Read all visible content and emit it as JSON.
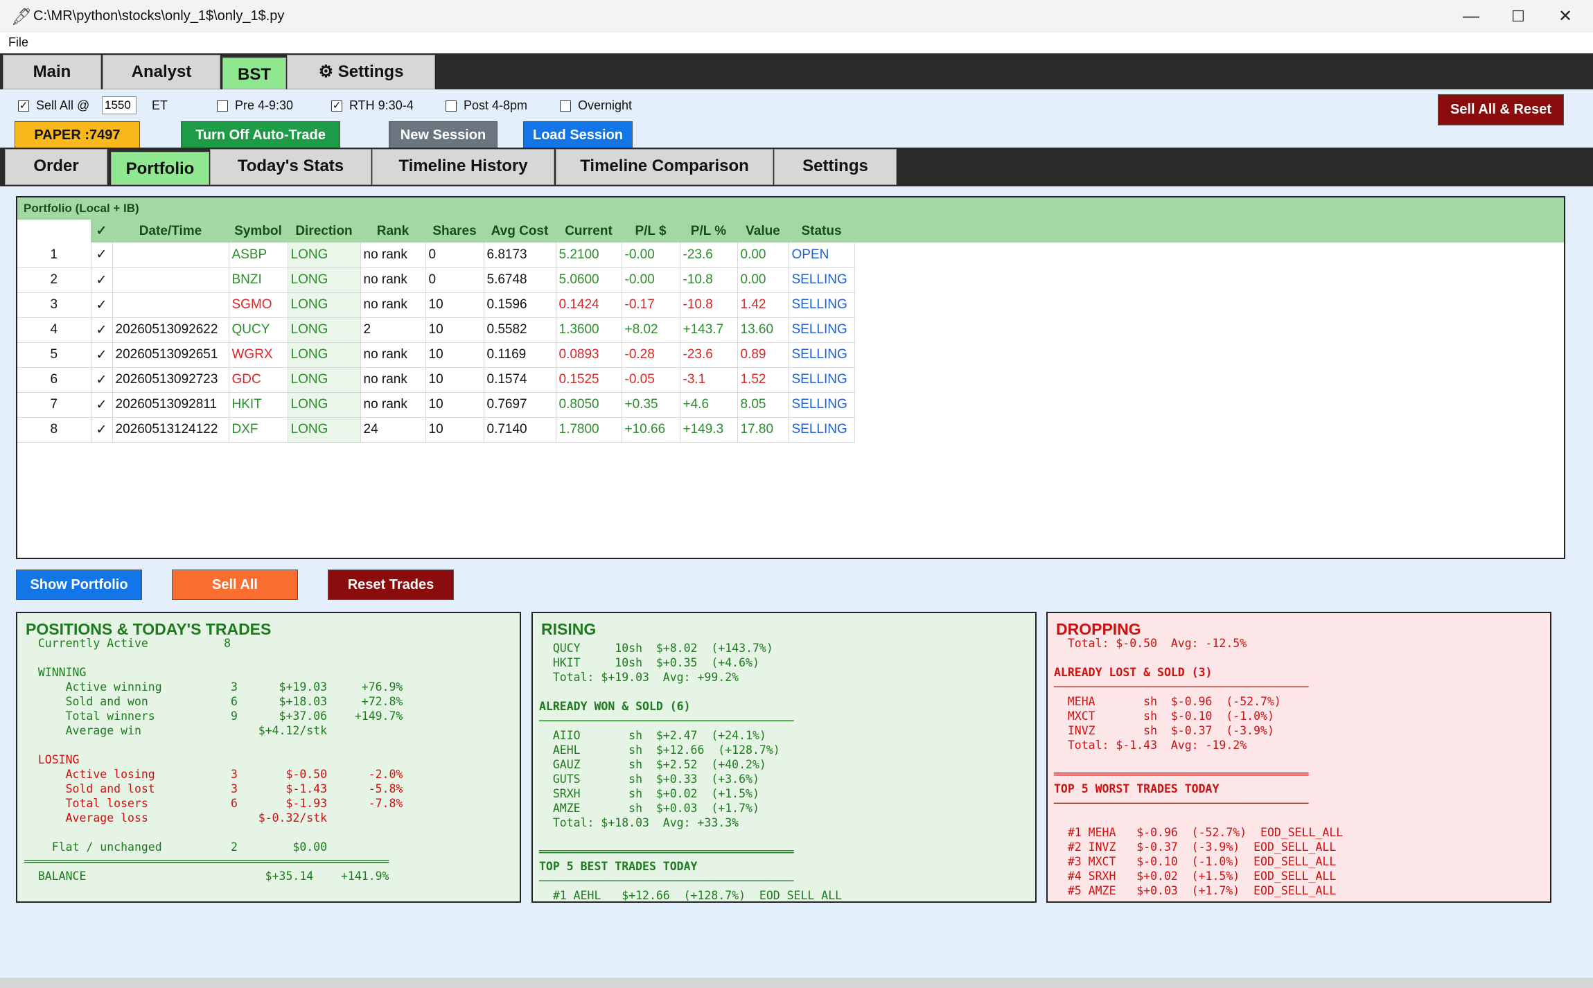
{
  "window": {
    "title": "C:\\MR\\python\\stocks\\only_1$\\only_1$.py",
    "minimize": "—",
    "maximize": "☐",
    "close": "✕"
  },
  "menu": {
    "file": "File"
  },
  "top_tabs": [
    {
      "label": "Main"
    },
    {
      "label": "Analyst"
    },
    {
      "label": "BST"
    },
    {
      "label": "⚙ Settings"
    }
  ],
  "controls": {
    "sell_all_label": "Sell All @",
    "sell_all_checked": "✓",
    "sell_all_time": "1550",
    "et_label": "ET",
    "pre_label": "Pre 4-9:30",
    "rth_label": "RTH 9:30-4",
    "rth_checked": "✓",
    "post_label": "Post 4-8pm",
    "overnight_label": "Overnight",
    "sell_all_reset": "Sell All & Reset",
    "paper": "PAPER :7497",
    "auto_trade": "Turn Off Auto-Trade",
    "new_session": "New Session",
    "load_session": "Load Session"
  },
  "sub_tabs": [
    {
      "label": "Order"
    },
    {
      "label": "Portfolio"
    },
    {
      "label": "Today's Stats"
    },
    {
      "label": "Timeline History"
    },
    {
      "label": "Timeline Comparison"
    },
    {
      "label": "Settings"
    }
  ],
  "portfolio": {
    "title": "Portfolio (Local + IB)",
    "headers": [
      "",
      "✓",
      "Date/Time",
      "Symbol",
      "Direction",
      "Rank",
      "Shares",
      "Avg Cost",
      "Current",
      "P/L $",
      "P/L %",
      "Value",
      "Status"
    ],
    "rows": [
      [
        "1",
        "✓",
        "",
        "ASBP",
        "LONG",
        "no rank",
        "0",
        "6.8173",
        "5.2100",
        "-0.00",
        "-23.6",
        "0.00",
        "OPEN"
      ],
      [
        "2",
        "✓",
        "",
        "BNZI",
        "LONG",
        "no rank",
        "0",
        "5.6748",
        "5.0600",
        "-0.00",
        "-10.8",
        "0.00",
        "SELLING"
      ],
      [
        "3",
        "✓",
        "",
        "SGMO",
        "LONG",
        "no rank",
        "10",
        "0.1596",
        "0.1424",
        "-0.17",
        "-10.8",
        "1.42",
        "SELLING"
      ],
      [
        "4",
        "✓",
        "20260513092622",
        "QUCY",
        "LONG",
        "2",
        "10",
        "0.5582",
        "1.3600",
        "+8.02",
        "+143.7",
        "13.60",
        "SELLING"
      ],
      [
        "5",
        "✓",
        "20260513092651",
        "WGRX",
        "LONG",
        "no rank",
        "10",
        "0.1169",
        "0.0893",
        "-0.28",
        "-23.6",
        "0.89",
        "SELLING"
      ],
      [
        "6",
        "✓",
        "20260513092723",
        "GDC",
        "LONG",
        "no rank",
        "10",
        "0.1574",
        "0.1525",
        "-0.05",
        "-3.1",
        "1.52",
        "SELLING"
      ],
      [
        "7",
        "✓",
        "20260513092811",
        "HKIT",
        "LONG",
        "no rank",
        "10",
        "0.7697",
        "0.8050",
        "+0.35",
        "+4.6",
        "8.05",
        "SELLING"
      ],
      [
        "8",
        "✓",
        "20260513124122",
        "DXF",
        "LONG",
        "24",
        "10",
        "0.7140",
        "1.7800",
        "+10.66",
        "+149.3",
        "17.80",
        "SELLING"
      ]
    ],
    "row_tones": [
      "green",
      "green",
      "red",
      "green",
      "red",
      "red",
      "green",
      "green"
    ]
  },
  "actions": {
    "show_portfolio": "Show Portfolio",
    "sell_all": "Sell All",
    "reset_trades": "Reset Trades"
  },
  "positions_panel": {
    "title": "POSITIONS & TODAY'S TRADES",
    "lines": [
      {
        "text": "  Currently Active           8",
        "tone": "green"
      },
      {
        "text": "",
        "tone": "green"
      },
      {
        "text": "  WINNING",
        "tone": "green"
      },
      {
        "text": "      Active winning          3      $+19.03     +76.9%",
        "tone": "green"
      },
      {
        "text": "      Sold and won            6      $+18.03     +72.8%",
        "tone": "green"
      },
      {
        "text": "      Total winners           9      $+37.06    +149.7%",
        "tone": "green"
      },
      {
        "text": "      Average win                 $+4.12/stk",
        "tone": "green"
      },
      {
        "text": "",
        "tone": "green"
      },
      {
        "text": "  LOSING",
        "tone": "red"
      },
      {
        "text": "      Active losing           3       $-0.50      -2.0%",
        "tone": "red"
      },
      {
        "text": "      Sold and lost           3       $-1.43      -5.8%",
        "tone": "red"
      },
      {
        "text": "      Total losers            6       $-1.93      -7.8%",
        "tone": "red"
      },
      {
        "text": "      Average loss                $-0.32/stk",
        "tone": "red"
      },
      {
        "text": "",
        "tone": "green"
      },
      {
        "text": "    Flat / unchanged          2        $0.00",
        "tone": "green"
      },
      {
        "text": "═════════════════════════════════════════════════════",
        "tone": "green"
      },
      {
        "text": "  BALANCE                          $+35.14    +141.9%",
        "tone": "green"
      }
    ]
  },
  "rising_panel": {
    "title": "RISING",
    "lines": [
      {
        "text": "  QUCY     10sh  $+8.02  (+143.7%)",
        "tone": "green"
      },
      {
        "text": "  HKIT     10sh  $+0.35  (+4.6%)",
        "tone": "green"
      },
      {
        "text": "  Total: $+19.03  Avg: +99.2%",
        "tone": "green"
      },
      {
        "text": "",
        "tone": "green"
      },
      {
        "text": "ALREADY WON & SOLD (6)",
        "tone": "green",
        "bold": true
      },
      {
        "text": "─────────────────────────────────────",
        "tone": "green"
      },
      {
        "text": "  AIIO       sh  $+2.47  (+24.1%)",
        "tone": "green"
      },
      {
        "text": "  AEHL       sh  $+12.66  (+128.7%)",
        "tone": "green"
      },
      {
        "text": "  GAUZ       sh  $+2.52  (+40.2%)",
        "tone": "green"
      },
      {
        "text": "  GUTS       sh  $+0.33  (+3.6%)",
        "tone": "green"
      },
      {
        "text": "  SRXH       sh  $+0.02  (+1.5%)",
        "tone": "green"
      },
      {
        "text": "  AMZE       sh  $+0.03  (+1.7%)",
        "tone": "green"
      },
      {
        "text": "  Total: $+18.03  Avg: +33.3%",
        "tone": "green"
      },
      {
        "text": "",
        "tone": "green"
      },
      {
        "text": "═════════════════════════════════════",
        "tone": "green"
      },
      {
        "text": "TOP 5 BEST TRADES TODAY",
        "tone": "green",
        "bold": true
      },
      {
        "text": "─────────────────────────────────────",
        "tone": "green"
      },
      {
        "text": "  #1 AEHL   $+12.66  (+128.7%)  EOD_SELL_ALL",
        "tone": "green"
      }
    ]
  },
  "dropping_panel": {
    "title": "DROPPING",
    "lines": [
      {
        "text": "  Total: $-0.50  Avg: -12.5%",
        "tone": "red"
      },
      {
        "text": "",
        "tone": "red"
      },
      {
        "text": "ALREADY LOST & SOLD (3)",
        "tone": "red",
        "bold": true
      },
      {
        "text": "─────────────────────────────────────",
        "tone": "red"
      },
      {
        "text": "  MEHA       sh  $-0.96  (-52.7%)",
        "tone": "red"
      },
      {
        "text": "  MXCT       sh  $-0.10  (-1.0%)",
        "tone": "red"
      },
      {
        "text": "  INVZ       sh  $-0.37  (-3.9%)",
        "tone": "red"
      },
      {
        "text": "  Total: $-1.43  Avg: -19.2%",
        "tone": "red"
      },
      {
        "text": "",
        "tone": "red"
      },
      {
        "text": "═════════════════════════════════════",
        "tone": "red"
      },
      {
        "text": "TOP 5 WORST TRADES TODAY",
        "tone": "red",
        "bold": true
      },
      {
        "text": "─────────────────────────────────────",
        "tone": "red"
      },
      {
        "text": "",
        "tone": "red"
      },
      {
        "text": "  #1 MEHA   $-0.96  (-52.7%)  EOD_SELL_ALL",
        "tone": "red"
      },
      {
        "text": "  #2 INVZ   $-0.37  (-3.9%)  EOD_SELL_ALL",
        "tone": "red"
      },
      {
        "text": "  #3 MXCT   $-0.10  (-1.0%)  EOD_SELL_ALL",
        "tone": "red"
      },
      {
        "text": "  #4 SRXH   $+0.02  (+1.5%)  EOD_SELL_ALL",
        "tone": "red"
      },
      {
        "text": "  #5 AMZE   $+0.03  (+1.7%)  EOD_SELL_ALL",
        "tone": "red"
      }
    ]
  },
  "colors": {
    "green_text": "#2e8b2e",
    "red_text": "#d62828",
    "blue_status": "#1f5fd0",
    "tab_active": "#8fe88f",
    "panel_green": "#e6f4e6",
    "panel_red": "#fde6e8",
    "header_green": "#a3d8a3"
  }
}
